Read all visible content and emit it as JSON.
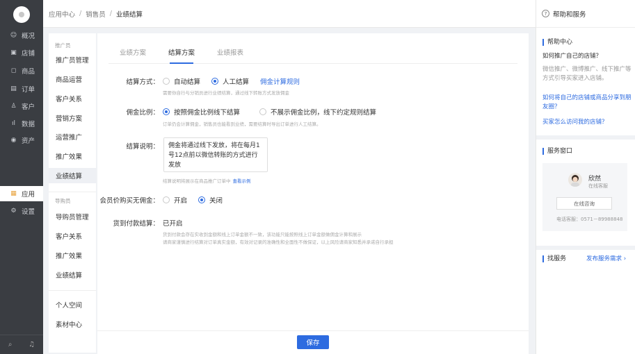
{
  "nav": {
    "items": [
      {
        "icon": "☺",
        "label": "概况"
      },
      {
        "icon": "▣",
        "label": "店铺"
      },
      {
        "icon": "◻",
        "label": "商品"
      },
      {
        "icon": "▤",
        "label": "订单"
      },
      {
        "icon": "♙",
        "label": "客户"
      },
      {
        "icon": "ıl",
        "label": "数据"
      },
      {
        "icon": "◉",
        "label": "资产"
      },
      {
        "icon": "▦",
        "label": "应用"
      },
      {
        "icon": "⚙",
        "label": "设置"
      }
    ],
    "bottom": {
      "search_icon": "⌕",
      "bell_icon": "♫"
    }
  },
  "breadcrumb": {
    "items": [
      "应用中心",
      "销售员",
      "业绩结算"
    ],
    "separator": "/"
  },
  "subnav": {
    "group1": "推广员",
    "group1_items": [
      "推广员管理",
      "商品运营",
      "客户关系",
      "营销方案",
      "运营推广",
      "推广效果",
      "业绩结算"
    ],
    "group2": "导购员",
    "group2_items": [
      "导购员管理",
      "客户关系",
      "推广效果",
      "业绩结算"
    ],
    "extra_items": [
      "个人空间",
      "素材中心"
    ]
  },
  "tabs": [
    "业绩方案",
    "结算方案",
    "业绩报表"
  ],
  "form": {
    "settle_method": {
      "label": "结算方式：",
      "options": [
        "自动结算",
        "人工结算"
      ],
      "link": "佣金计算规则",
      "hint": "需要你自行与分销员进行业绩结算，通过线下转账方式发放佣金"
    },
    "commission_ratio": {
      "label": "佣金比例：",
      "options": [
        "按照佣金比例线下结算",
        "不展示佣金比例，线下约定规则结算"
      ],
      "hint": "订单仍会计算佣金，销售员也能看到业绩，需要结算时导出订单进行人工结算。"
    },
    "settle_desc": {
      "label": "结算说明：",
      "value": "佣金将通过线下发放，将在每月1号12点前以微信转账的方式进行发放",
      "hint": "结算说明将展示在商品推广订单中",
      "hint_link": "查看示例"
    },
    "member_price": {
      "label": "会员价购买无佣金：",
      "options": [
        "开启",
        "关闭"
      ]
    },
    "cod": {
      "label": "货到付款结算：",
      "value": "已开启",
      "hint1": "货到付款会存在实收到金额和线上订单金额不一致，该功能只能按照线上订单金额做佣金计算和展示",
      "hint2": "请商家谨慎进行结算对订单真实金额，有效对记录的准确性和全面性不做保证，以上风险请商家知悉并承诺自行承担"
    },
    "save": "保存"
  },
  "right": {
    "header": "帮助和服务",
    "help_center_title": "帮助中心",
    "q1": "如何推广自己的店铺？",
    "q1_desc": "微信推广、微博推广、线下推广等方式引导买家进入店铺。",
    "q2": "如何将自己的店铺或商品分享到朋友圈？",
    "q3": "买家怎么访问我的店铺？",
    "service_title": "服务窗口",
    "agent_name": "欣然",
    "agent_role": "在线客服",
    "consult": "在线咨询",
    "phone": "电话客服：0571－89988848",
    "find_service": "找服务",
    "publish": "发布服务需求 ›"
  },
  "colors": {
    "accent": "#2d6be0",
    "nav_bg": "#3a3d42"
  }
}
